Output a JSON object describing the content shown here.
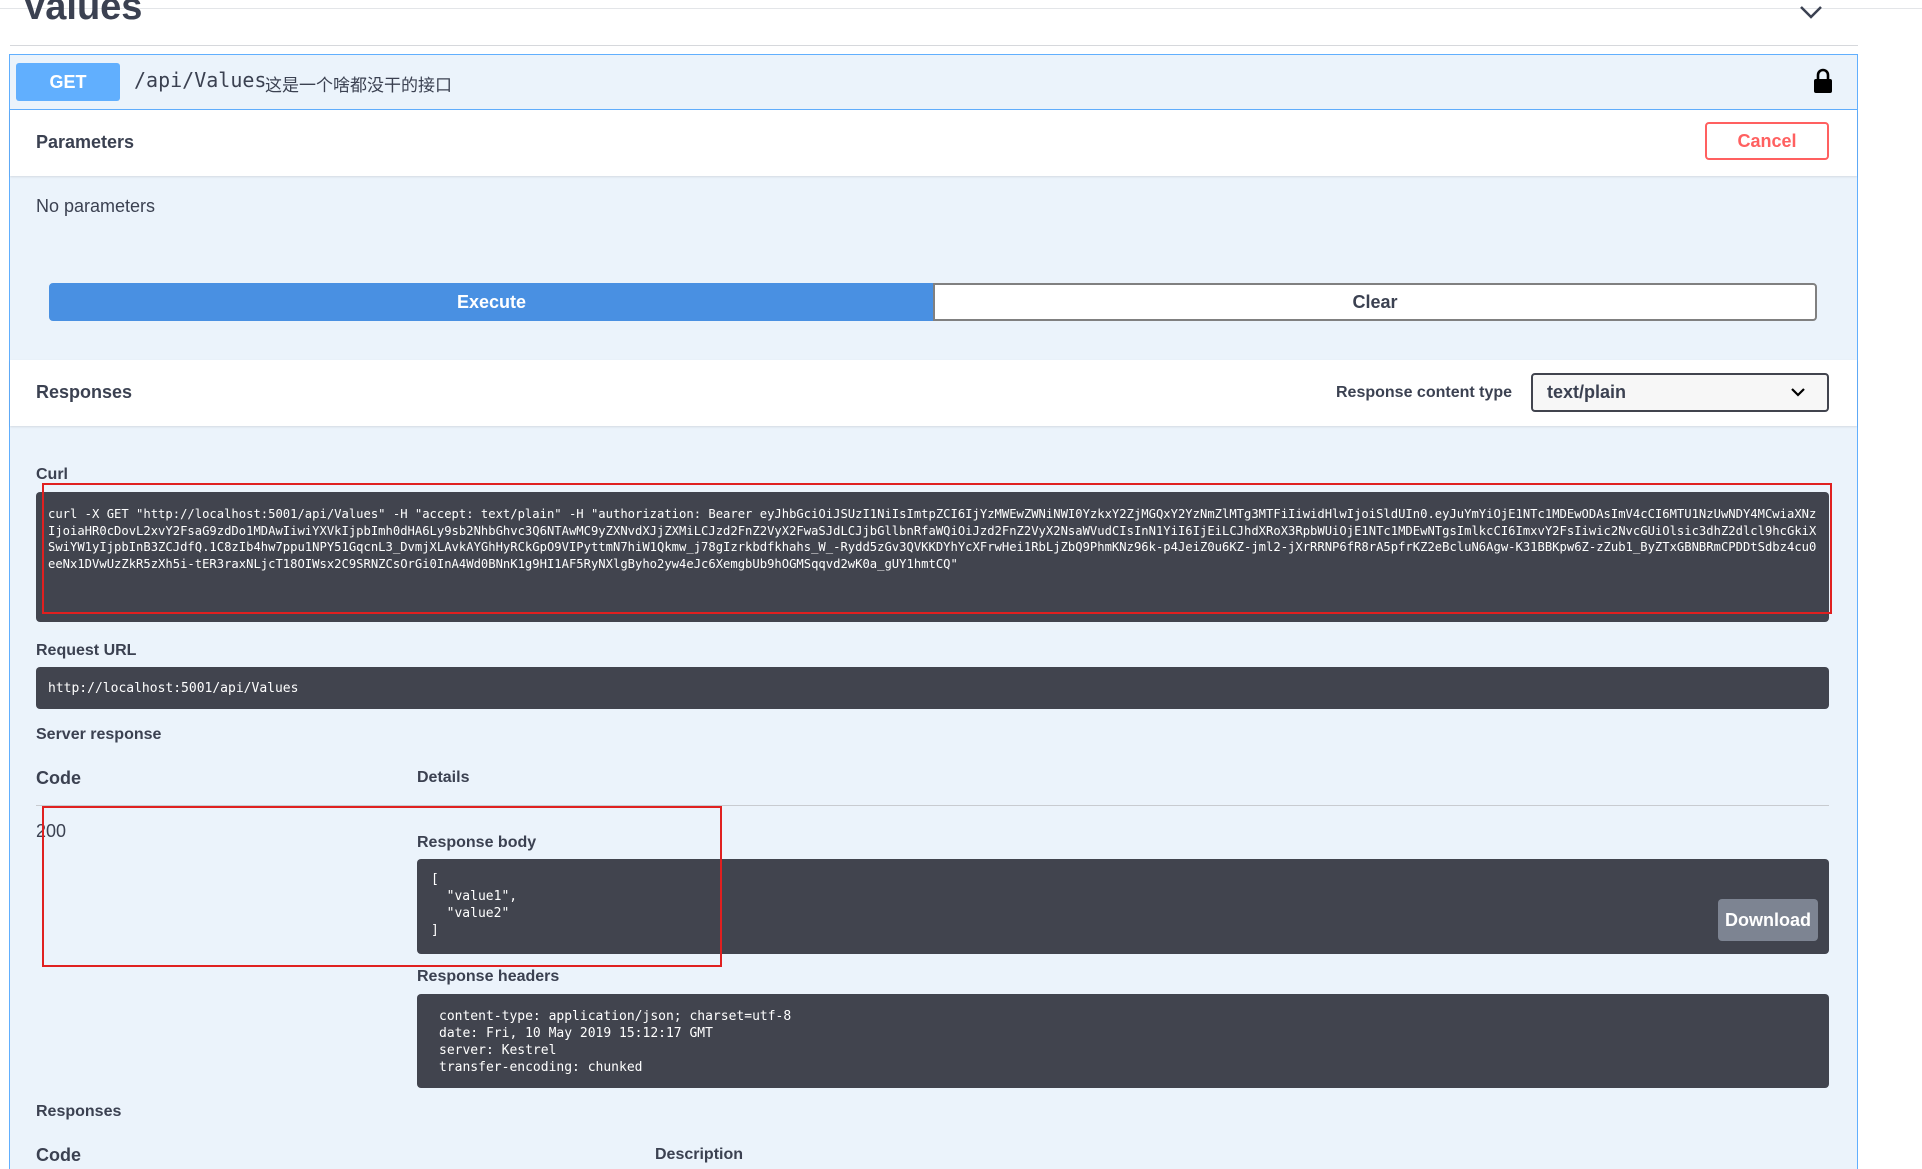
{
  "section": {
    "title": "Values"
  },
  "operation": {
    "method": "GET",
    "path": "/api/Values",
    "description": "这是一个啥都没干的接口"
  },
  "parameters": {
    "title": "Parameters",
    "cancel_label": "Cancel",
    "empty_text": "No parameters"
  },
  "actions": {
    "execute_label": "Execute",
    "clear_label": "Clear"
  },
  "responses_header": {
    "title": "Responses",
    "content_type_label": "Response content type",
    "content_type_value": "text/plain"
  },
  "curl": {
    "label": "Curl",
    "command": "curl -X GET \"http://localhost:5001/api/Values\" -H \"accept: text/plain\" -H \"authorization: Bearer eyJhbGciOiJSUzI1NiIsImtpZCI6IjYzMWEwZWNiNWI0YzkxY2ZjMGQxY2YzNmZlMTg3MTFiIiwidHlwIjoiSldUIn0.eyJuYmYiOjE1NTc1MDEwODAsImV4cCI6MTU1NzUwNDY4MCwiaXNzIjoiaHR0cDovL2xvY2FsaG9zdDo1MDAwIiwiYXVkIjpbImh0dHA6Ly9sb2NhbGhvc3Q6NTAwMC9yZXNvdXJjZXMiLCJzd2FnZ2VyX2FwaSJdLCJjbGllbnRfaWQiOiJzd2FnZ2VyX2NsaWVudCIsInN1YiI6IjEiLCJhdXRoX3RpbWUiOjE1NTc1MDEwNTgsImlkcCI6ImxvY2FsIiwic2NvcGUiOlsic3dhZ2dlcl9hcGkiXSwiYW1yIjpbInB3ZCJdfQ.1C8zIb4hw7ppu1NPY51GqcnL3_DvmjXLAvkAYGhHyRCkGpO9VIPyttmN7hiW1Qkmw_j78gIzrkbdfkhahs_W_-Rydd5zGv3QVKKDYhYcXFrwHei1RbLjZbQ9PhmKNz96k-p4JeiZ0u6KZ-jml2-jXrRRNP6fR8rA5pfrKZ2eBcluN6Agw-K31BBKpw6Z-zZub1_ByZTxGBNBRmCPDDtSdbz4cu0eeNx1DVwUzZkR5zXh5i-tER3raxNLjcT18OIWsx2C9SRNZCsOrGi0InA4Wd0BNnK1g9HI1AF5RyNXlgByho2yw4eJc6XemgbUb9hOGMSqqvd2wK0a_gUY1hmtCQ\""
  },
  "request_url": {
    "label": "Request URL",
    "value": "http://localhost:5001/api/Values"
  },
  "server_response": {
    "label": "Server response",
    "col_code": "Code",
    "col_details": "Details",
    "code": "200",
    "body_label": "Response body",
    "body": "[\n  \"value1\",\n  \"value2\"\n]",
    "download_label": "Download",
    "headers_label": "Response headers",
    "headers": "content-type: application/json; charset=utf-8\ndate: Fri, 10 May 2019 15:12:17 GMT\nserver: Kestrel\ntransfer-encoding: chunked"
  },
  "responses_table": {
    "label": "Responses",
    "col_code": "Code",
    "col_description": "Description"
  },
  "colors": {
    "get_method": "#61affe",
    "execute": "#4990e2",
    "cancel": "#ff6060",
    "dark_panel": "#41444e",
    "annotation": "#e02020"
  }
}
